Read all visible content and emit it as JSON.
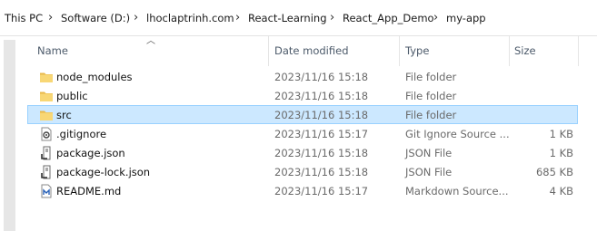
{
  "breadcrumb": {
    "items": [
      "This PC",
      "Software (D:)",
      "lhoclaptrinh.com",
      "React-Learning",
      "React_App_Demo",
      "my-app"
    ]
  },
  "columns": {
    "name": "Name",
    "date": "Date modified",
    "type": "Type",
    "size": "Size"
  },
  "files": [
    {
      "name": "node_modules",
      "date": "2023/11/16 15:18",
      "type": "File folder",
      "size": "",
      "icon": "folder-icon"
    },
    {
      "name": "public",
      "date": "2023/11/16 15:18",
      "type": "File folder",
      "size": "",
      "icon": "folder-icon"
    },
    {
      "name": "src",
      "date": "2023/11/16 15:18",
      "type": "File folder",
      "size": "",
      "icon": "folder-icon",
      "selected": true
    },
    {
      "name": ".gitignore",
      "date": "2023/11/16 15:17",
      "type": "Git Ignore Source ...",
      "size": "1 KB",
      "icon": "gear-file-icon"
    },
    {
      "name": "package.json",
      "date": "2023/11/16 15:18",
      "type": "JSON File",
      "size": "1 KB",
      "icon": "json-file-icon"
    },
    {
      "name": "package-lock.json",
      "date": "2023/11/16 15:18",
      "type": "JSON File",
      "size": "685 KB",
      "icon": "json-file-icon"
    },
    {
      "name": "README.md",
      "date": "2023/11/16 15:17",
      "type": "Markdown Source...",
      "size": "4 KB",
      "icon": "markdown-file-icon"
    }
  ],
  "colors": {
    "selection_bg": "#cce8ff",
    "selection_border": "#99d1ff",
    "folder_yellow": "#f8d775"
  }
}
